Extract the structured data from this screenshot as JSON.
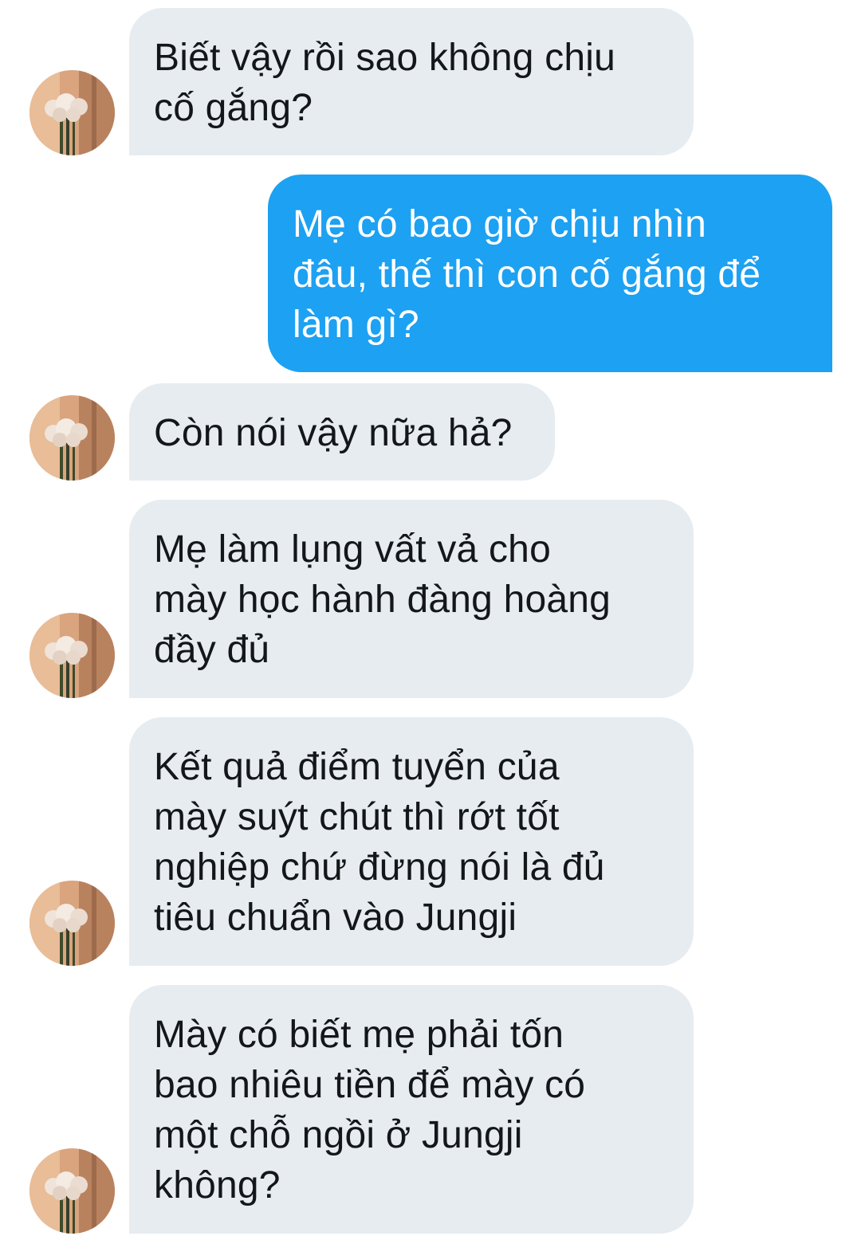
{
  "conversation": {
    "messages": [
      {
        "sender": "other",
        "text": "Biết vậy rồi sao không chịu\ncố gắng?"
      },
      {
        "sender": "me",
        "text": "Mẹ có bao giờ chịu nhìn\nđâu, thế thì con cố gắng để\nlàm gì?"
      },
      {
        "sender": "other",
        "text": "Còn nói vậy nữa hả?"
      },
      {
        "sender": "other",
        "text": "Mẹ làm lụng vất vả cho\nmày học hành đàng hoàng\nđầy đủ"
      },
      {
        "sender": "other",
        "text": "Kết quả điểm tuyển của\nmày suýt chút thì rớt tốt\nnghiệp chứ đừng nói là đủ\ntiêu chuẩn vào Jungji"
      },
      {
        "sender": "other",
        "text": "Mày có biết mẹ phải tốn\nbao nhiêu tiền để mày có\nmột chỗ ngồi ở Jungji\nkhông?"
      }
    ]
  },
  "colors": {
    "incoming_bubble": "#e6ecf0",
    "outgoing_bubble": "#1da1f2",
    "incoming_text": "#14171a",
    "outgoing_text": "#ffffff"
  },
  "avatar": {
    "icon": "flower-bouquet-avatar-icon"
  }
}
